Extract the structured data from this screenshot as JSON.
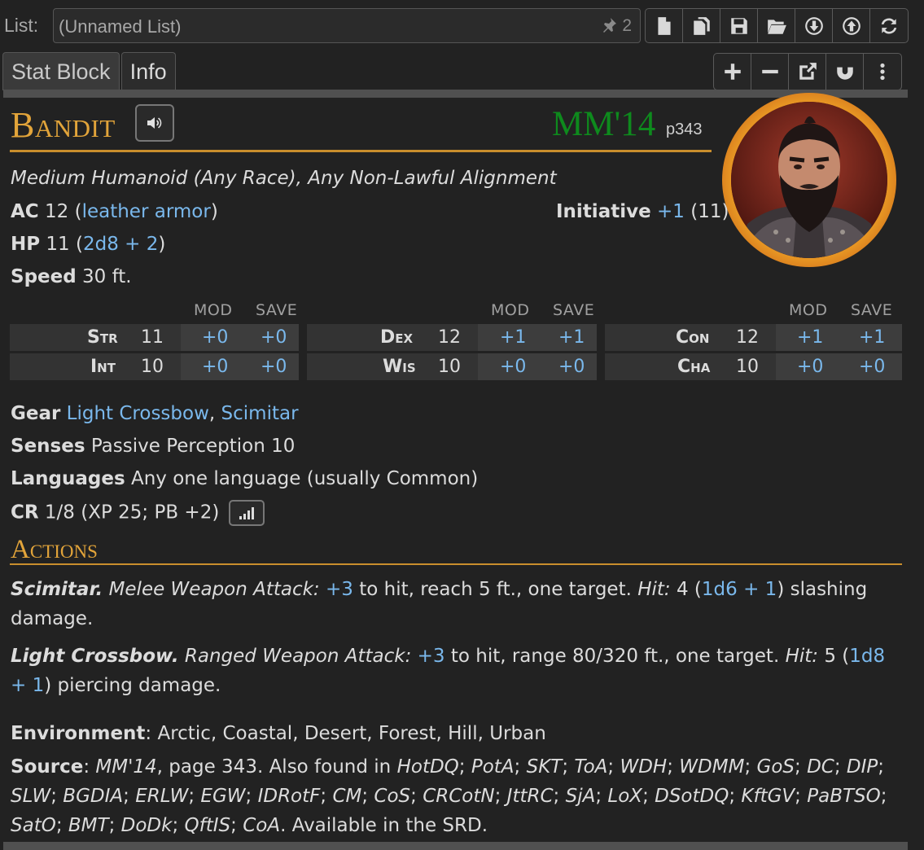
{
  "listbar": {
    "label": "List:",
    "value": "(Unnamed List)",
    "pin_count": "2",
    "buttons": [
      "new-file-icon",
      "copy-icon",
      "save-icon",
      "open-folder-icon",
      "download-icon",
      "upload-icon",
      "refresh-icon"
    ]
  },
  "tabs": [
    {
      "label": "Stat Block",
      "active": true
    },
    {
      "label": "Info",
      "active": false
    }
  ],
  "right_buttons": [
    "plus-icon",
    "minus-icon",
    "popout-icon",
    "magnet-icon",
    "more-vert-icon"
  ],
  "creature": {
    "name": "Bandit",
    "source_abbr": "MM'14",
    "source_page": "p343",
    "type_line": "Medium Humanoid (Any Race), Any Non-Lawful Alignment",
    "ac_label": "AC",
    "ac_value": "12",
    "ac_note": "leather armor",
    "initiative_label": "Initiative",
    "initiative_mod": "+1",
    "initiative_score": "(11)",
    "hp_label": "HP",
    "hp_value": "11",
    "hp_formula": "2d8 + 2",
    "speed_label": "Speed",
    "speed_value": "30 ft.",
    "ability_headers": {
      "mod": "MOD",
      "save": "SAVE"
    },
    "abilities": [
      {
        "name": "Str",
        "score": "11",
        "mod": "+0",
        "save": "+0"
      },
      {
        "name": "Dex",
        "score": "12",
        "mod": "+1",
        "save": "+1"
      },
      {
        "name": "Con",
        "score": "12",
        "mod": "+1",
        "save": "+1"
      },
      {
        "name": "Int",
        "score": "10",
        "mod": "+0",
        "save": "+0"
      },
      {
        "name": "Wis",
        "score": "10",
        "mod": "+0",
        "save": "+0"
      },
      {
        "name": "Cha",
        "score": "10",
        "mod": "+0",
        "save": "+0"
      }
    ],
    "gear_label": "Gear",
    "gear": [
      "Light Crossbow",
      "Scimitar"
    ],
    "senses_label": "Senses",
    "senses_value": "Passive Perception 10",
    "languages_label": "Languages",
    "languages_value": "Any one language (usually Common)",
    "cr_label": "CR",
    "cr_value": "1/8 (XP 25; PB +2)",
    "actions_title": "Actions",
    "actions": [
      {
        "name": "Scimitar.",
        "attack_type": "Melee Weapon Attack:",
        "to_hit": "+3",
        "desc1": " to hit, reach 5 ft., one target. ",
        "hit_label": "Hit:",
        "avg": " 4 (",
        "dice": "1d6 + 1",
        "desc2": ") slashing damage."
      },
      {
        "name": "Light Crossbow.",
        "attack_type": "Ranged Weapon Attack:",
        "to_hit": "+3",
        "desc1": " to hit, range 80/320 ft., one target. ",
        "hit_label": "Hit:",
        "avg": " 5 (",
        "dice": "1d8 + 1",
        "desc2": ") piercing damage."
      }
    ],
    "environment_label": "Environment",
    "environment_value": ": Arctic, Coastal, Desert, Forest, Hill, Urban",
    "source_label": "Source",
    "source_primary": "MM'14",
    "source_primary_rest": ", page 343. Also found in ",
    "source_books": [
      "HotDQ",
      "PotA",
      "SKT",
      "ToA",
      "WDH",
      "WDMM",
      "GoS",
      "DC",
      "DIP",
      "SLW",
      "BGDIA",
      "ERLW",
      "EGW",
      "IDRotF",
      "CM",
      "CoS",
      "CRCotN",
      "JttRC",
      "SjA",
      "LoX",
      "DSotDQ",
      "KftGV",
      "PaBTSO",
      "SatO",
      "BMT",
      "DoDk",
      "QftIS",
      "CoA"
    ],
    "source_tail": ". Available in the SRD."
  },
  "colors": {
    "name_gold": "#e2a43a",
    "source_green": "#0e8a1d",
    "link_blue": "#7ab8ec",
    "background": "#222222"
  }
}
